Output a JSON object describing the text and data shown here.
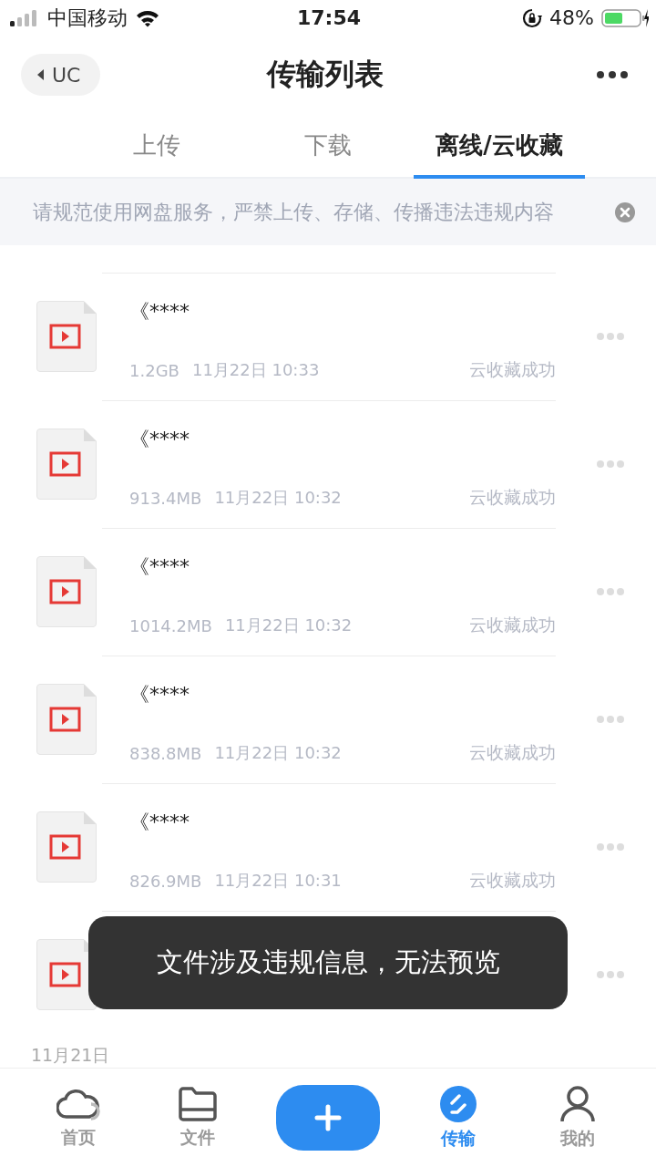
{
  "status_bar": {
    "carrier": "中国移动",
    "time": "17:54",
    "battery": "48%"
  },
  "header": {
    "back": "UC",
    "title": "传输列表"
  },
  "tabs": [
    {
      "label": "上传",
      "selected": false
    },
    {
      "label": "下载",
      "selected": false
    },
    {
      "label": "离线/云收藏",
      "selected": true
    }
  ],
  "notice": {
    "text": "请规范使用网盘服务，严禁上传、存储、传播违法违规内容"
  },
  "files": [
    {
      "name": "《****",
      "size": "1.2GB",
      "time": "11月22日 10:33",
      "status": "云收藏成功"
    },
    {
      "name": "《****",
      "size": "913.4MB",
      "time": "11月22日 10:32",
      "status": "云收藏成功"
    },
    {
      "name": "《****",
      "size": "1014.2MB",
      "time": "11月22日 10:32",
      "status": "云收藏成功"
    },
    {
      "name": "《****",
      "size": "838.8MB",
      "time": "11月22日 10:32",
      "status": "云收藏成功"
    },
    {
      "name": "《****",
      "size": "826.9MB",
      "time": "11月22日 10:31",
      "status": "云收藏成功"
    },
    {
      "kind": "covered"
    }
  ],
  "section_date": "11月21日",
  "toast": "文件涉及违规信息，无法预览",
  "nav": [
    {
      "kind": "home",
      "label": "首页",
      "selected": false
    },
    {
      "kind": "files",
      "label": "文件",
      "selected": false
    },
    {
      "kind": "add"
    },
    {
      "kind": "transfer",
      "label": "传输",
      "selected": true
    },
    {
      "kind": "me",
      "label": "我的",
      "selected": false
    }
  ]
}
